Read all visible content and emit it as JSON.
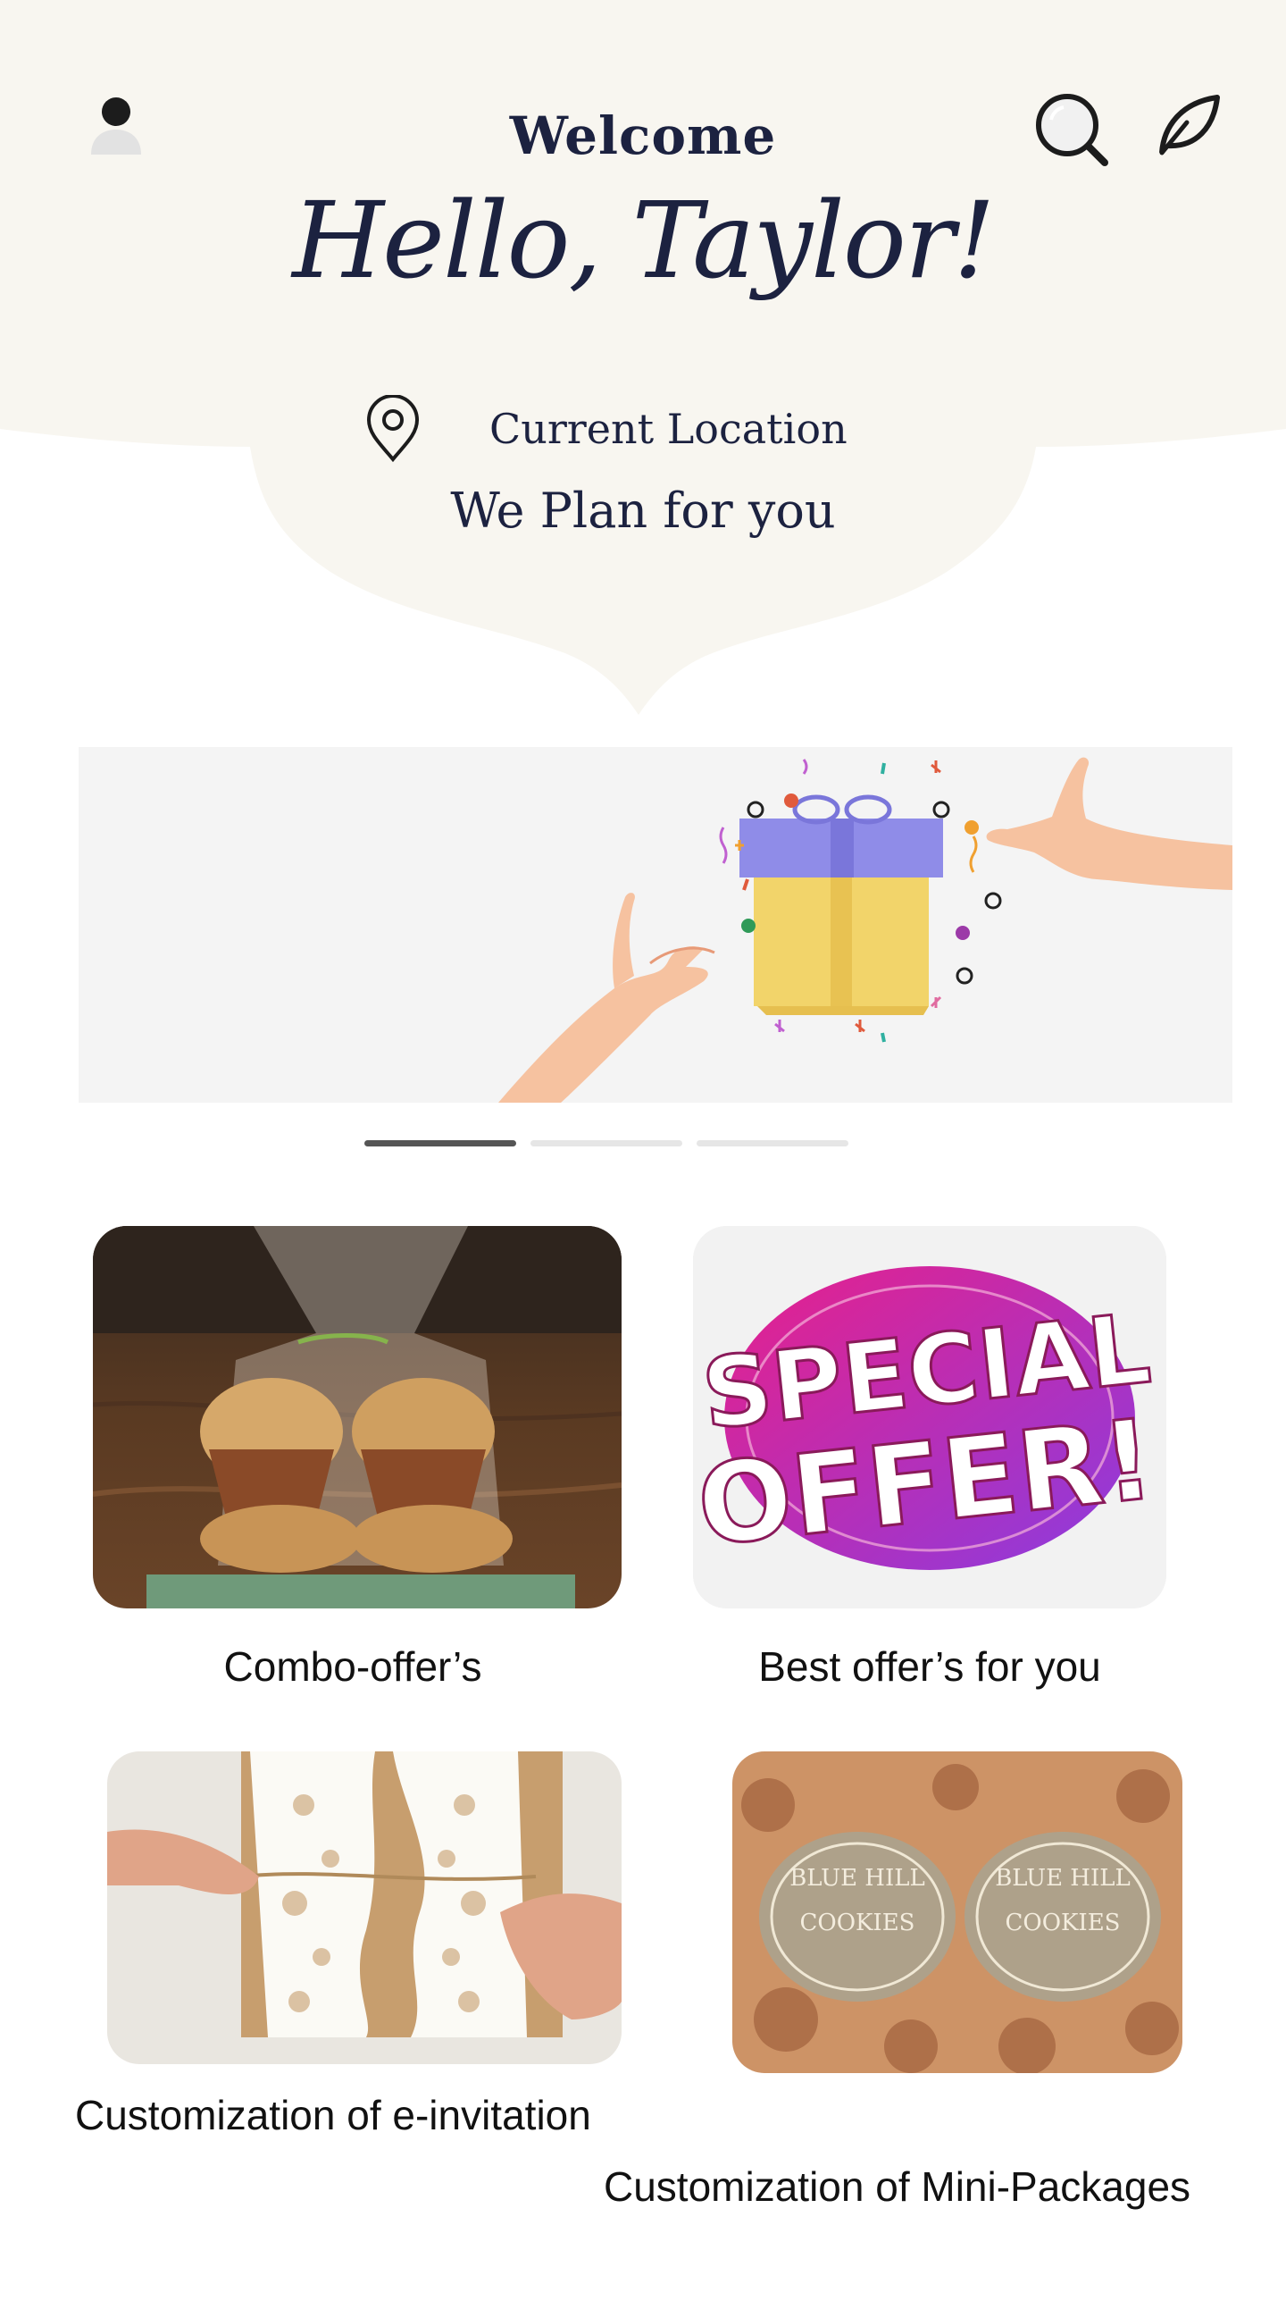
{
  "header": {
    "welcome": "Welcome",
    "greeting": "Hello, Taylor!",
    "location_label": "Current Location",
    "tagline": "We Plan for you"
  },
  "icons": {
    "profile": "person-icon",
    "search": "search-icon",
    "leaf": "leaf-icon",
    "location": "location-pin-icon"
  },
  "banner": {
    "image": "gift-box-illustration",
    "pagination": {
      "count": 3,
      "active": 0
    }
  },
  "tiles": [
    {
      "label": "Combo-offer’s",
      "image": "muffins-in-bag"
    },
    {
      "label": "Best offer’s for you",
      "image": "special-offer-badge",
      "badge_line1": "SPECIAL",
      "badge_line2": "OFFER!"
    },
    {
      "label": "Customization of e-invitation",
      "image": "lace-invitation-card"
    },
    {
      "label": "Customization of Mini-Packages",
      "image": "cookie-packages",
      "package_text_1": "BLUE HILL",
      "package_text_2": "COOKIES"
    }
  ],
  "colors": {
    "header_bg": "#f8f6f0",
    "text_dark": "#1c2240",
    "banner_bg": "#f4f4f4",
    "offer_pink": "#e8208a",
    "offer_purple": "#8a3ce0"
  }
}
